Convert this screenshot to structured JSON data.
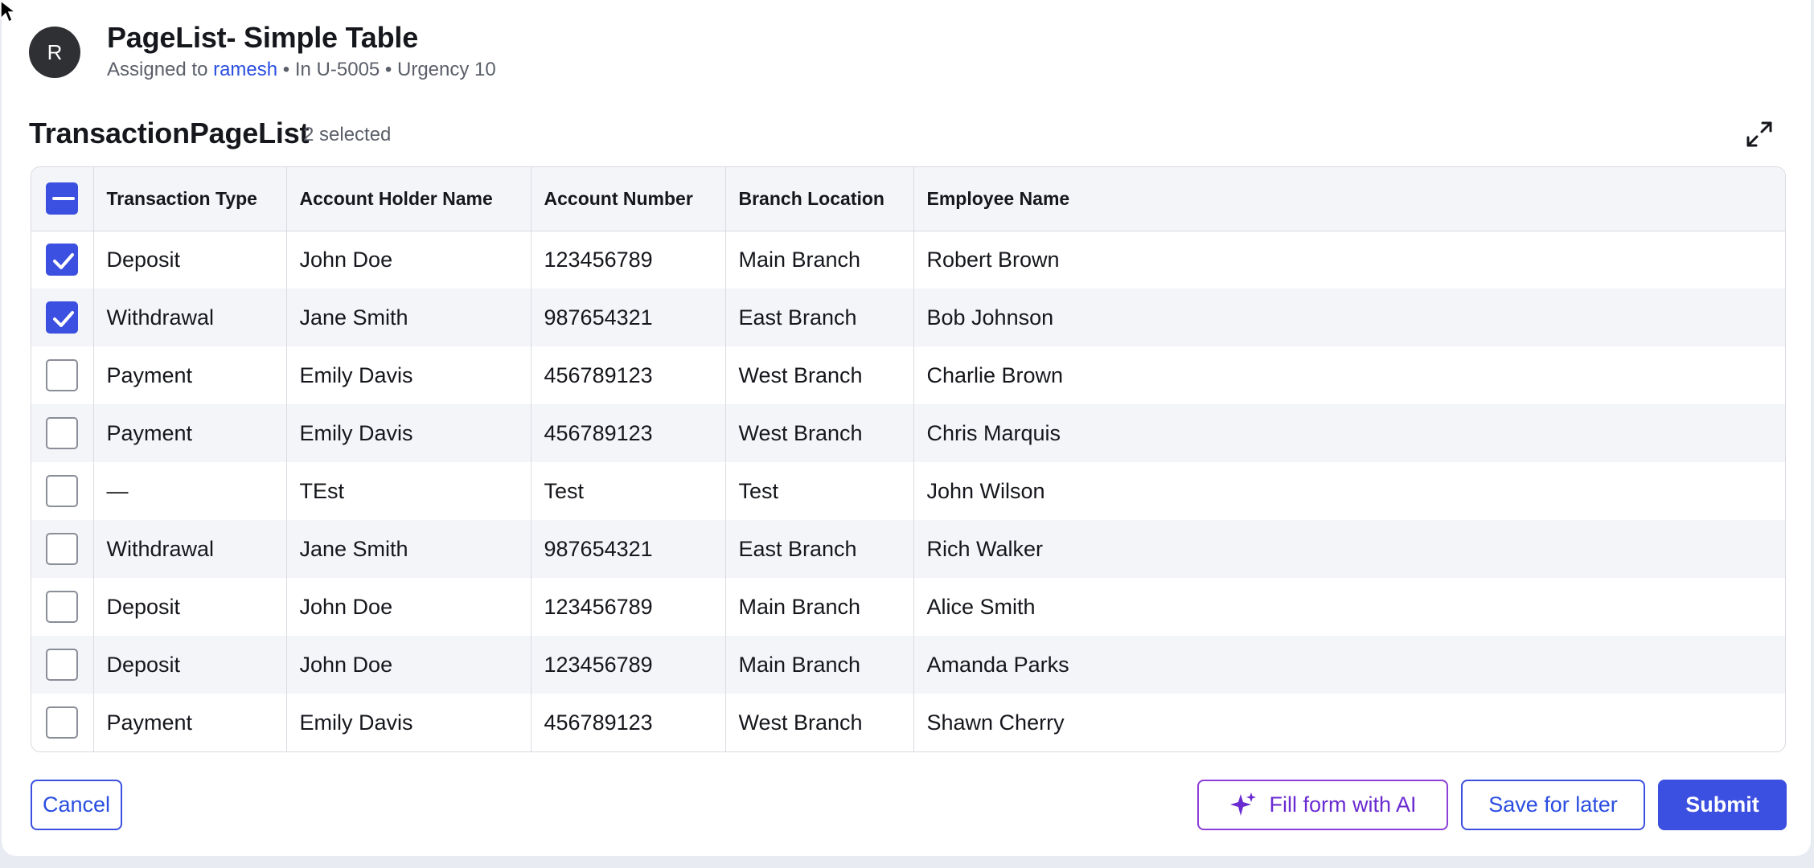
{
  "header": {
    "avatar_initial": "R",
    "title": "PageList- Simple Table",
    "assigned_prefix": "Assigned to ",
    "assignee": "ramesh",
    "meta_rest": " • In U-5005 • Urgency 10"
  },
  "list": {
    "title": "TransactionPageList",
    "selected_count": "2 selected",
    "select_all_state": "mixed"
  },
  "table": {
    "columns": [
      "Transaction Type",
      "Account Holder Name",
      "Account Number",
      "Branch Location",
      "Employee Name"
    ],
    "rows": [
      {
        "selected": true,
        "cells": [
          "Deposit",
          "John Doe",
          "123456789",
          "Main Branch",
          "Robert Brown"
        ]
      },
      {
        "selected": true,
        "cells": [
          "Withdrawal",
          "Jane Smith",
          "987654321",
          "East Branch",
          "Bob Johnson"
        ]
      },
      {
        "selected": false,
        "cells": [
          "Payment",
          "Emily Davis",
          "456789123",
          "West Branch",
          "Charlie Brown"
        ]
      },
      {
        "selected": false,
        "cells": [
          "Payment",
          "Emily Davis",
          "456789123",
          "West Branch",
          "Chris Marquis"
        ]
      },
      {
        "selected": false,
        "cells": [
          "—",
          "TEst",
          "Test",
          "Test",
          "John Wilson"
        ]
      },
      {
        "selected": false,
        "cells": [
          "Withdrawal",
          "Jane Smith",
          "987654321",
          "East Branch",
          "Rich Walker"
        ]
      },
      {
        "selected": false,
        "cells": [
          "Deposit",
          "John Doe",
          "123456789",
          "Main Branch",
          "Alice Smith"
        ]
      },
      {
        "selected": false,
        "cells": [
          "Deposit",
          "John Doe",
          "123456789",
          "Main Branch",
          "Amanda Parks"
        ]
      },
      {
        "selected": false,
        "cells": [
          "Payment",
          "Emily Davis",
          "456789123",
          "West Branch",
          "Shawn Cherry"
        ]
      }
    ]
  },
  "actions": {
    "cancel_label": "Cancel",
    "ai_label": "Fill form with AI",
    "save_label": "Save for later",
    "submit_label": "Submit"
  },
  "colors": {
    "primary": "#3b4fe0",
    "ai_accent": "#8c3ed6",
    "row_stripe": "#f4f5f9",
    "avatar_bg": "#2f3033"
  },
  "icons": {
    "expand": "expand-icon",
    "ai": "sparkle-icon",
    "cursor": "mouse-cursor-icon"
  }
}
